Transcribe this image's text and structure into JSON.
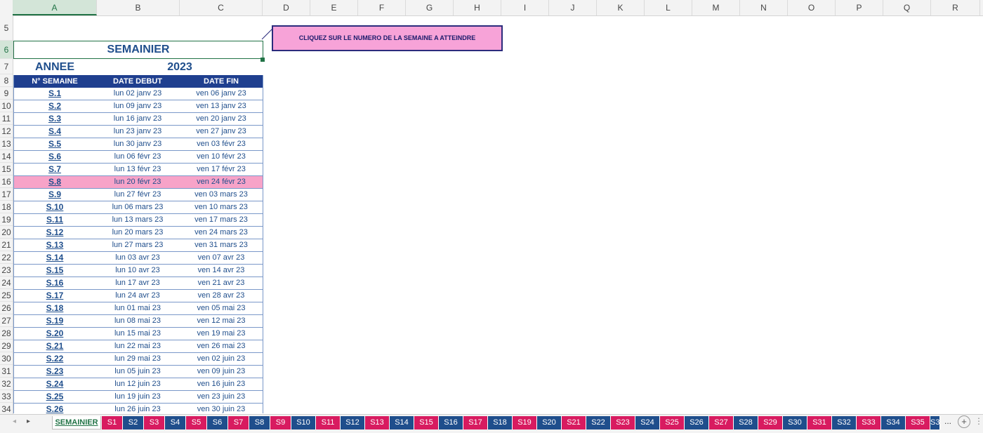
{
  "columns": [
    "A",
    "B",
    "C",
    "D",
    "E",
    "F",
    "G",
    "H",
    "I",
    "J",
    "K",
    "L",
    "M",
    "N",
    "O",
    "P",
    "Q",
    "R"
  ],
  "rows": [
    "5",
    "6",
    "7",
    "8",
    "9",
    "10",
    "11",
    "12",
    "13",
    "14",
    "15",
    "16",
    "17",
    "18",
    "19",
    "20",
    "21",
    "22",
    "23",
    "24",
    "25",
    "26",
    "27",
    "28",
    "29",
    "30",
    "31",
    "32",
    "33",
    "34"
  ],
  "title": "SEMAINIER",
  "annee_label": "ANNEE",
  "annee_value": "2023",
  "table": {
    "headers": [
      "N° SEMAINE",
      "DATE DEBUT",
      "DATE FIN"
    ],
    "rows": [
      [
        "S.1",
        "lun 02 janv 23",
        "ven 06 janv 23"
      ],
      [
        "S.2",
        "lun 09 janv 23",
        "ven 13 janv 23"
      ],
      [
        "S.3",
        "lun 16 janv 23",
        "ven 20 janv 23"
      ],
      [
        "S.4",
        "lun 23 janv 23",
        "ven 27 janv 23"
      ],
      [
        "S.5",
        "lun 30 janv 23",
        "ven 03 févr 23"
      ],
      [
        "S.6",
        "lun 06 févr 23",
        "ven 10 févr 23"
      ],
      [
        "S.7",
        "lun 13 févr 23",
        "ven 17 févr 23"
      ],
      [
        "S.8",
        "lun 20 févr 23",
        "ven 24 févr 23"
      ],
      [
        "S.9",
        "lun 27 févr 23",
        "ven 03 mars 23"
      ],
      [
        "S.10",
        "lun 06 mars 23",
        "ven 10 mars 23"
      ],
      [
        "S.11",
        "lun 13 mars 23",
        "ven 17 mars 23"
      ],
      [
        "S.12",
        "lun 20 mars 23",
        "ven 24 mars 23"
      ],
      [
        "S.13",
        "lun 27 mars 23",
        "ven 31 mars 23"
      ],
      [
        "S.14",
        "lun 03 avr 23",
        "ven 07 avr 23"
      ],
      [
        "S.15",
        "lun 10 avr 23",
        "ven 14 avr 23"
      ],
      [
        "S.16",
        "lun 17 avr 23",
        "ven 21 avr 23"
      ],
      [
        "S.17",
        "lun 24 avr 23",
        "ven 28 avr 23"
      ],
      [
        "S.18",
        "lun 01 mai 23",
        "ven 05 mai 23"
      ],
      [
        "S.19",
        "lun 08 mai 23",
        "ven 12 mai 23"
      ],
      [
        "S.20",
        "lun 15 mai 23",
        "ven 19 mai 23"
      ],
      [
        "S.21",
        "lun 22 mai 23",
        "ven 26 mai 23"
      ],
      [
        "S.22",
        "lun 29 mai 23",
        "ven 02 juin 23"
      ],
      [
        "S.23",
        "lun 05 juin 23",
        "ven 09 juin 23"
      ],
      [
        "S.24",
        "lun 12 juin 23",
        "ven 16 juin 23"
      ],
      [
        "S.25",
        "lun 19 juin 23",
        "ven 23 juin 23"
      ],
      [
        "S.26",
        "lun 26 juin 23",
        "ven 30 juin 23"
      ]
    ],
    "highlight_week": "S.8"
  },
  "callout_text": "CLIQUEZ SUR LE NUMERO DE LA SEMAINE A ATTEINDRE",
  "tabs": {
    "active": "SEMAINIER",
    "items": [
      "S1",
      "S2",
      "S3",
      "S4",
      "S5",
      "S6",
      "S7",
      "S8",
      "S9",
      "S10",
      "S11",
      "S12",
      "S13",
      "S14",
      "S15",
      "S16",
      "S17",
      "S18",
      "S19",
      "S20",
      "S21",
      "S22",
      "S23",
      "S24",
      "S25",
      "S26",
      "S27",
      "S28",
      "S29",
      "S30",
      "S31",
      "S32",
      "S33",
      "S34",
      "S35",
      "S3"
    ],
    "more": "...",
    "add": "+"
  },
  "colors": {
    "pink_tab": "#d81b60",
    "blue_tab": "#1f4e8c",
    "header_bg": "#1f3f8f",
    "highlight": "#f7a3c8",
    "accent": "#217346"
  }
}
